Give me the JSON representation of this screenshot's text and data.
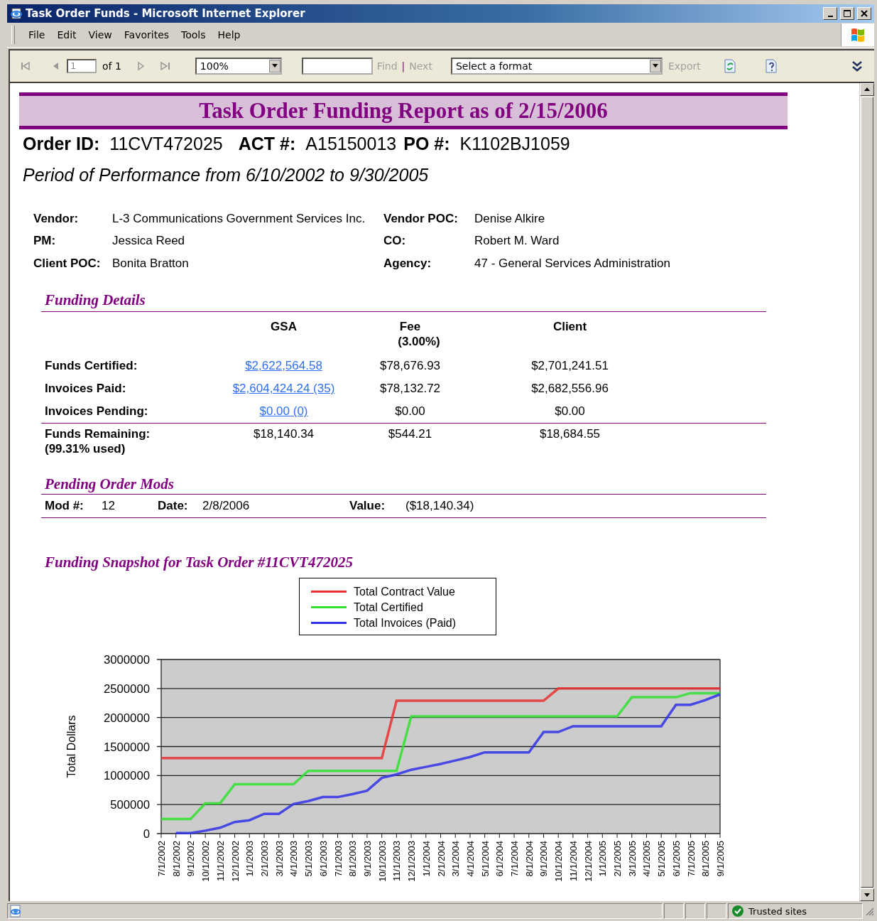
{
  "window": {
    "title": "Task Order Funds - Microsoft Internet Explorer"
  },
  "menu": [
    {
      "label": "File"
    },
    {
      "label": "Edit"
    },
    {
      "label": "View"
    },
    {
      "label": "Favorites"
    },
    {
      "label": "Tools"
    },
    {
      "label": "Help"
    }
  ],
  "toolbar": {
    "page": "1",
    "page_count": "of 1",
    "zoom": "100%",
    "find": "Find",
    "separator": "|",
    "next": "Next",
    "format": "Select a format",
    "export": "Export"
  },
  "report": {
    "title": "Task Order Funding Report as of 2/15/2006",
    "ids": [
      {
        "label": "Order ID:",
        "value": "11CVT472025"
      },
      {
        "label": "ACT #:",
        "value": "A15150013"
      },
      {
        "label": "PO #:",
        "value": "K1102BJ1059"
      }
    ],
    "period": "Period of Performance from 6/10/2002 to 9/30/2005",
    "info": [
      {
        "label": "Vendor:",
        "value": "L-3 Communications Government Services Inc."
      },
      {
        "label": "Vendor POC:",
        "value": "Denise Alkire"
      },
      {
        "label": "PM:",
        "value": "Jessica Reed"
      },
      {
        "label": "CO:",
        "value": "Robert M. Ward"
      },
      {
        "label": "Client POC:",
        "value": "Bonita Bratton"
      },
      {
        "label": "Agency:",
        "value": "47 - General Services Administration"
      }
    ],
    "funding": {
      "heading": "Funding Details",
      "columns": [
        {
          "label": "GSA"
        },
        {
          "label": "Fee",
          "note": "(3.00%)"
        },
        {
          "label": "Client"
        }
      ],
      "rows": [
        {
          "label": "Funds Certified:",
          "cells": [
            {
              "text": "$2,622,564.58",
              "link": true
            },
            {
              "text": "$78,676.93",
              "link": false
            },
            {
              "text": "$2,701,241.51",
              "link": false
            }
          ]
        },
        {
          "label": "Invoices Paid:",
          "cells": [
            {
              "text": "$2,604,424.24 (35)",
              "link": true
            },
            {
              "text": "$78,132.72",
              "link": false
            },
            {
              "text": "$2,682,556.96",
              "link": false
            }
          ]
        },
        {
          "label": "Invoices Pending:",
          "cells": [
            {
              "text": "$0.00 (0)",
              "link": true
            },
            {
              "text": "$0.00",
              "link": false
            },
            {
              "text": "$0.00",
              "link": false
            }
          ]
        }
      ],
      "total": {
        "label": "Funds Remaining:",
        "note": "(99.31% used)",
        "cells": [
          "$18,140.34",
          "$544.21",
          "$18,684.55"
        ]
      }
    },
    "mods": {
      "heading": "Pending Order Mods",
      "fields": [
        {
          "label": "Mod #:",
          "value": "12"
        },
        {
          "label": "Date:",
          "value": "2/8/2006"
        },
        {
          "label": "Value:",
          "value": "($18,140.34)"
        }
      ]
    },
    "snapshot": {
      "heading": "Funding Snapshot for Task Order #11CVT472025",
      "chart_data": {
        "type": "line",
        "grid": true,
        "ylabel": "Total Dollars",
        "ylim": [
          0,
          3000000
        ],
        "yticks": [
          0,
          500000,
          1000000,
          1500000,
          2000000,
          2500000,
          3000000
        ],
        "categories": [
          "7/1/2002",
          "8/1/2002",
          "9/1/2002",
          "10/1/2002",
          "11/1/2002",
          "12/1/2002",
          "1/1/2003",
          "2/1/2003",
          "3/1/2003",
          "4/1/2003",
          "5/1/2003",
          "6/1/2003",
          "7/1/2003",
          "8/1/2003",
          "9/1/2003",
          "10/1/2003",
          "11/1/2003",
          "12/1/2003",
          "1/1/2004",
          "2/1/2004",
          "3/1/2004",
          "4/1/2004",
          "5/1/2004",
          "6/1/2004",
          "7/1/2004",
          "8/1/2004",
          "9/1/2004",
          "10/1/2004",
          "11/1/2004",
          "12/1/2004",
          "1/1/2005",
          "2/1/2005",
          "3/1/2005",
          "4/1/2005",
          "5/1/2005",
          "6/1/2005",
          "7/1/2005",
          "8/1/2005",
          "9/1/2005"
        ],
        "series": [
          {
            "name": "Total Contract Value",
            "color": "#e83030",
            "values": [
              1300000,
              1300000,
              1300000,
              1300000,
              1300000,
              1300000,
              1300000,
              1300000,
              1300000,
              1300000,
              1300000,
              1300000,
              1300000,
              1300000,
              1300000,
              1300000,
              2290000,
              2290000,
              2290000,
              2290000,
              2290000,
              2290000,
              2290000,
              2290000,
              2290000,
              2290000,
              2290000,
              2500000,
              2500000,
              2500000,
              2500000,
              2500000,
              2500000,
              2500000,
              2500000,
              2500000,
              2500000,
              2500000,
              2500000
            ]
          },
          {
            "name": "Total Certified",
            "color": "#30e030",
            "values": [
              250000,
              250000,
              250000,
              520000,
              520000,
              850000,
              850000,
              850000,
              850000,
              850000,
              1080000,
              1080000,
              1080000,
              1080000,
              1080000,
              1080000,
              1080000,
              2020000,
              2020000,
              2020000,
              2020000,
              2020000,
              2020000,
              2020000,
              2020000,
              2020000,
              2020000,
              2020000,
              2020000,
              2020000,
              2020000,
              2020000,
              2350000,
              2350000,
              2350000,
              2350000,
              2420000,
              2420000,
              2420000
            ]
          },
          {
            "name": "Total Invoices (Paid)",
            "color": "#3030e8",
            "values": [
              null,
              10000,
              10000,
              50000,
              100000,
              200000,
              230000,
              340000,
              340000,
              510000,
              560000,
              630000,
              630000,
              680000,
              740000,
              960000,
              1020000,
              1100000,
              1150000,
              1200000,
              1260000,
              1320000,
              1400000,
              1400000,
              1400000,
              1400000,
              1750000,
              1750000,
              1850000,
              1850000,
              1850000,
              1850000,
              1850000,
              1850000,
              1850000,
              2220000,
              2220000,
              2300000,
              2400000
            ]
          }
        ]
      }
    }
  },
  "status_bar": {
    "zone": "Trusted sites"
  }
}
